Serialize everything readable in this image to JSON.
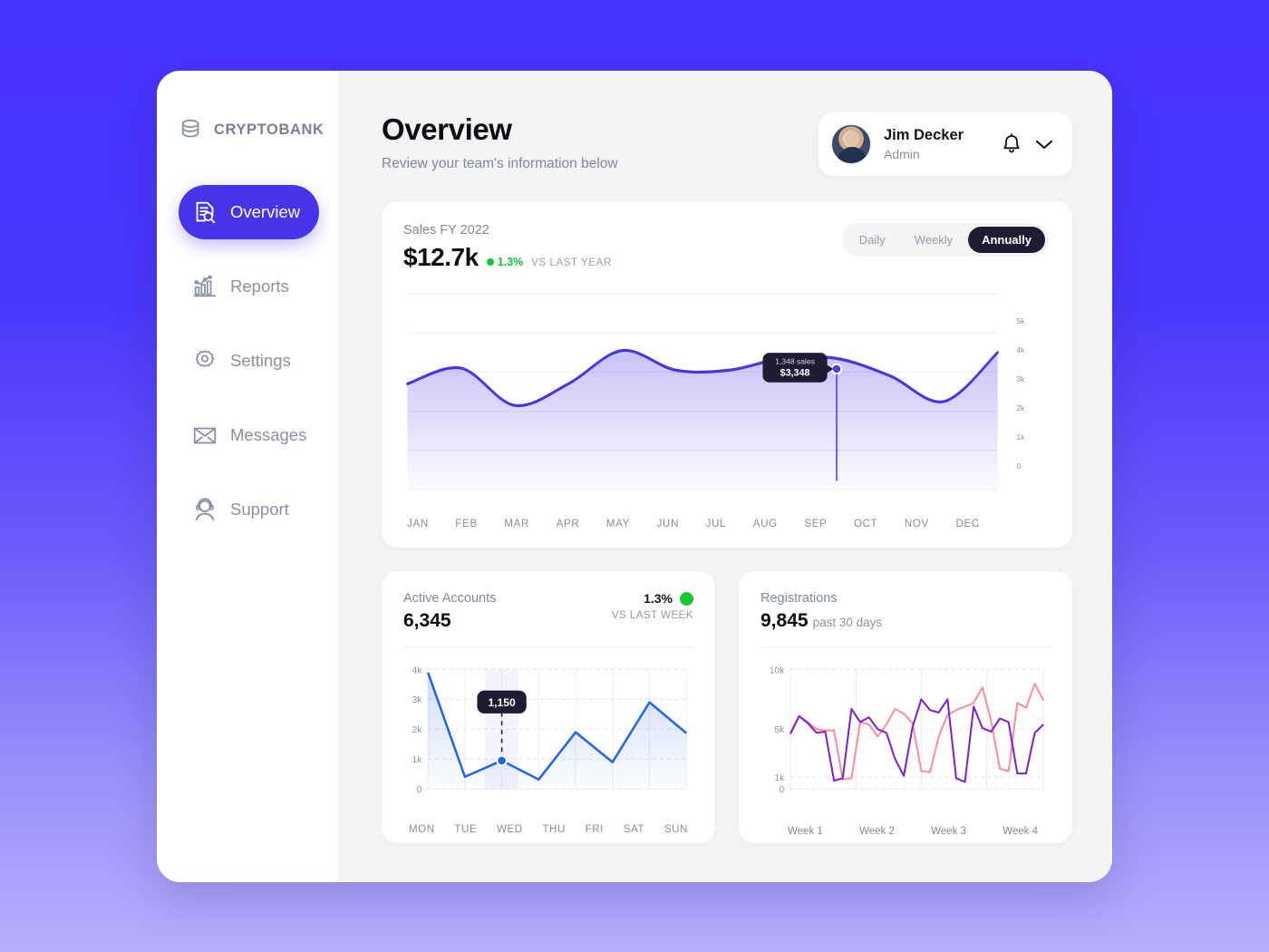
{
  "brand": {
    "name": "CRYPTOBANK",
    "icon": "stacked-coins-icon"
  },
  "sidebar": {
    "items": [
      {
        "label": "Overview",
        "icon": "document-search-icon",
        "active": true
      },
      {
        "label": "Reports",
        "icon": "bar-chart-icon",
        "active": false
      },
      {
        "label": "Settings",
        "icon": "gear-icon",
        "active": false
      },
      {
        "label": "Messages",
        "icon": "envelope-icon",
        "active": false
      },
      {
        "label": "Support",
        "icon": "headset-person-icon",
        "active": false
      }
    ]
  },
  "header": {
    "title": "Overview",
    "subtitle": "Review your team's information below",
    "user": {
      "name": "Jim Decker",
      "role": "Admin",
      "avatar": "user-photo",
      "bell": "bell-icon",
      "chevron": "chevron-down-icon"
    }
  },
  "sales_card": {
    "label": "Sales FY 2022",
    "value": "$12.7k",
    "delta": "1.3%",
    "delta_sub": "VS LAST YEAR",
    "delta_color": "#17c42f",
    "segments": [
      {
        "label": "Daily",
        "active": false
      },
      {
        "label": "Weekly",
        "active": false
      },
      {
        "label": "Annually",
        "active": true
      }
    ],
    "tooltip": {
      "line1": "1,348 sales",
      "line2": "$3,348"
    }
  },
  "active_accounts_card": {
    "label": "Active Accounts",
    "value": "6,345",
    "pct": "1.3%",
    "pct_sub": "VS LAST WEEK",
    "tooltip": "1,150"
  },
  "registrations_card": {
    "label": "Registrations",
    "value": "9,845",
    "suffix": "past 30 days"
  },
  "chart_data": [
    {
      "id": "sales-chart",
      "type": "area",
      "title": "Sales FY 2022",
      "categories": [
        "JAN",
        "FEB",
        "MAR",
        "APR",
        "MAY",
        "JUN",
        "JUL",
        "AUG",
        "SEP",
        "OCT",
        "NOV",
        "DEC"
      ],
      "values": [
        2700,
        3100,
        2150,
        2700,
        3550,
        3050,
        3050,
        3350,
        3348,
        2900,
        2250,
        3500
      ],
      "ylim": [
        0,
        5000
      ],
      "yticks": [
        "0",
        "1k",
        "2k",
        "3k",
        "4k",
        "5k"
      ],
      "ylabel": "",
      "xlabel": "",
      "line_color": "#4733E8",
      "grid": true,
      "axis_position": "right",
      "highlight": {
        "category": "SEP",
        "value": 3348,
        "label_sales": "1,348 sales",
        "label_amount": "$3,348"
      }
    },
    {
      "id": "active-accounts-chart",
      "type": "area",
      "title": "Active Accounts",
      "categories": [
        "MON",
        "TUE",
        "WED",
        "THU",
        "FRI",
        "SAT",
        "SUN"
      ],
      "values": [
        3900,
        410,
        950,
        320,
        1900,
        900,
        2900,
        1870
      ],
      "ylim": [
        0,
        4000
      ],
      "yticks": [
        "0",
        "1k",
        "2k",
        "3k",
        "4k"
      ],
      "line_color": "#2563eb",
      "grid": true,
      "highlight": {
        "category": "WED",
        "value": 1150,
        "label": "1,150"
      }
    },
    {
      "id": "registrations-chart",
      "type": "line",
      "title": "Registrations",
      "categories": [
        "Week 1",
        "Week 2",
        "Week 3",
        "Week 4"
      ],
      "yticks": [
        "0",
        "1k",
        "5k",
        "10k"
      ],
      "ylim": [
        0,
        10000
      ],
      "series": [
        {
          "name": "purple",
          "color": "#7c22ce",
          "values": [
            4600,
            6100,
            5500,
            4700,
            4800,
            700,
            900,
            6700,
            5600,
            6000,
            5000,
            4700,
            2500,
            1100,
            5200,
            7500,
            6600,
            6400,
            7500,
            900,
            600,
            6900,
            5100,
            4800,
            5900,
            5600,
            1300,
            1300,
            4700,
            5400
          ]
        },
        {
          "name": "pink",
          "color": "#f79098",
          "values": [
            4700,
            6100,
            5600,
            5000,
            4900,
            4900,
            800,
            900,
            5600,
            5400,
            4400,
            5400,
            6700,
            6300,
            5500,
            1500,
            1400,
            4400,
            6200,
            6600,
            6900,
            7200,
            8500,
            5700,
            1700,
            1500,
            7200,
            6800,
            8800,
            7400
          ]
        }
      ],
      "grid": true
    }
  ]
}
